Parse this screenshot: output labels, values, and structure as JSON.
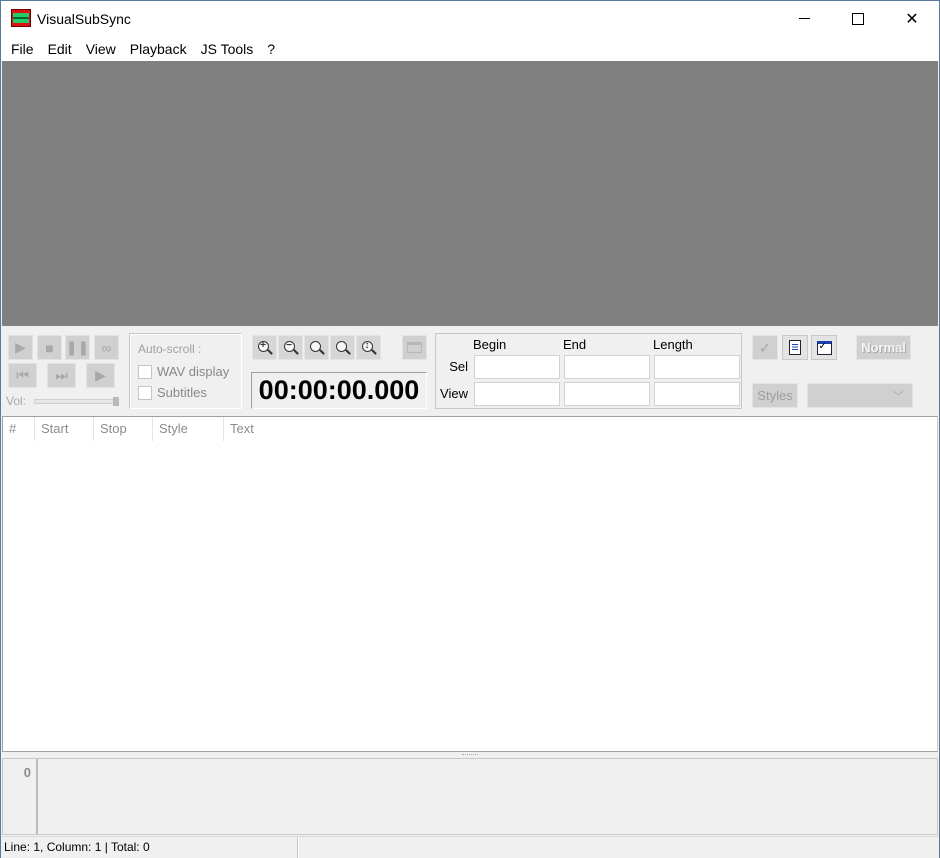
{
  "window": {
    "title": "VisualSubSync",
    "controls": {
      "minimize": "minimize",
      "maximize": "maximize",
      "close": "close"
    }
  },
  "menu": [
    "File",
    "Edit",
    "View",
    "Playback",
    "JS Tools",
    "?"
  ],
  "playback": {
    "buttons": [
      "play-icon",
      "stop-icon",
      "pause-icon",
      "loop-icon",
      "skip-back-icon",
      "skip-forward-icon",
      "play-to-end-icon"
    ],
    "volume_label": "Vol:",
    "volume_level": 1.0
  },
  "autoscroll": {
    "label": "Auto-scroll :",
    "options": [
      {
        "label": "WAV display",
        "checked": false
      },
      {
        "label": "Subtitles",
        "checked": false
      }
    ]
  },
  "zoom_tools": [
    "zoom-in-icon",
    "zoom-out-icon",
    "zoom-selection-icon",
    "zoom-all-icon",
    "zoom-vertical-icon"
  ],
  "timecode": "00:00:00.000",
  "selection_panel": {
    "columns": [
      "Begin",
      "End",
      "Length"
    ],
    "rows": [
      {
        "label": "Sel",
        "values": [
          "",
          "",
          ""
        ]
      },
      {
        "label": "View",
        "values": [
          "",
          "",
          ""
        ]
      }
    ]
  },
  "right_tools": {
    "normal_label": "Normal",
    "styles_label": "Styles",
    "style_select_value": ""
  },
  "list": {
    "columns": [
      "#",
      "Start",
      "Stop",
      "Style",
      "Text"
    ],
    "rows": []
  },
  "editor": {
    "line_number": "0",
    "text": ""
  },
  "status": {
    "position": "Line: 1, Column: 1 | Total: 0",
    "secondary": ""
  }
}
